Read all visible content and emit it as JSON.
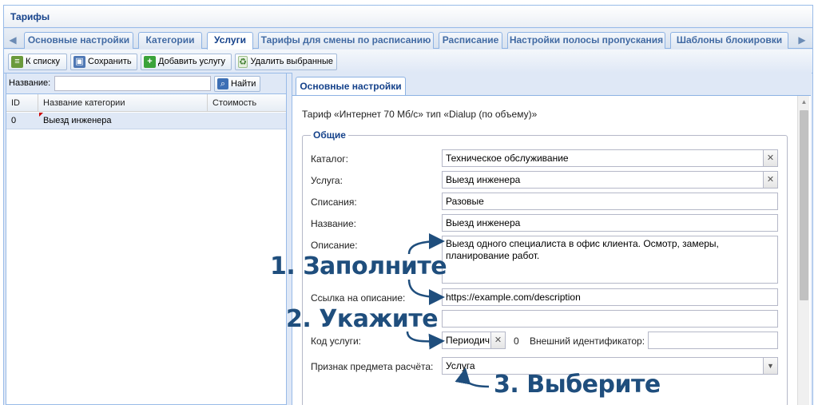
{
  "window": {
    "title": "Тарифы"
  },
  "tabs": [
    {
      "label": "Основные настройки",
      "active": false
    },
    {
      "label": "Категории",
      "active": false
    },
    {
      "label": "Услуги",
      "active": true
    },
    {
      "label": "Тарифы для смены по расписанию",
      "active": false
    },
    {
      "label": "Расписание",
      "active": false
    },
    {
      "label": "Настройки полосы пропускания",
      "active": false
    },
    {
      "label": "Шаблоны блокировки",
      "active": false
    }
  ],
  "toolbar": {
    "back_label": "К списку",
    "save_label": "Сохранить",
    "add_label": "Добавить услугу",
    "delete_label": "Удалить выбранные"
  },
  "search": {
    "label": "Название:",
    "value": "",
    "button_label": "Найти"
  },
  "grid": {
    "columns": [
      "ID",
      "Название категории",
      "Стоимость"
    ],
    "rows": [
      {
        "id": "0",
        "name": "Выезд инженера",
        "cost": ""
      }
    ]
  },
  "detail": {
    "tab_label": "Основные настройки",
    "description": "Тариф «Интернет 70 Мб/с» тип «Dialup (по объему)»",
    "fieldset_title": "Общие",
    "fields": {
      "catalog": {
        "label": "Каталог:",
        "value": "Техническое обслуживание"
      },
      "service": {
        "label": "Услуга:",
        "value": "Выезд инженера"
      },
      "charges": {
        "label": "Списания:",
        "value": "Разовые"
      },
      "name": {
        "label": "Название:",
        "value": "Выезд инженера"
      },
      "description": {
        "label": "Описание:",
        "value": "Выезд одного специалиста в офис клиента. Осмотр, замеры, планирование работ."
      },
      "description_link": {
        "label": "Ссылка на описание:",
        "value": "https://example.com/description"
      },
      "extra": {
        "label": "",
        "value": ""
      },
      "service_code": {
        "label": "Код услуги:",
        "value": "Периодич",
        "suffix": "0"
      },
      "external_id": {
        "label": "Внешний идентификатор:",
        "value": ""
      },
      "subject_attr": {
        "label": "Признак предмета расчёта:",
        "value": "Услуга"
      }
    }
  },
  "annotations": {
    "step1": "1. Заполните",
    "step2": "2. Укажите",
    "step3": "3. Выберите"
  },
  "colors": {
    "accent": "#15428b",
    "panel": "#dfe8f6",
    "annotation": "#1f4e7d"
  }
}
